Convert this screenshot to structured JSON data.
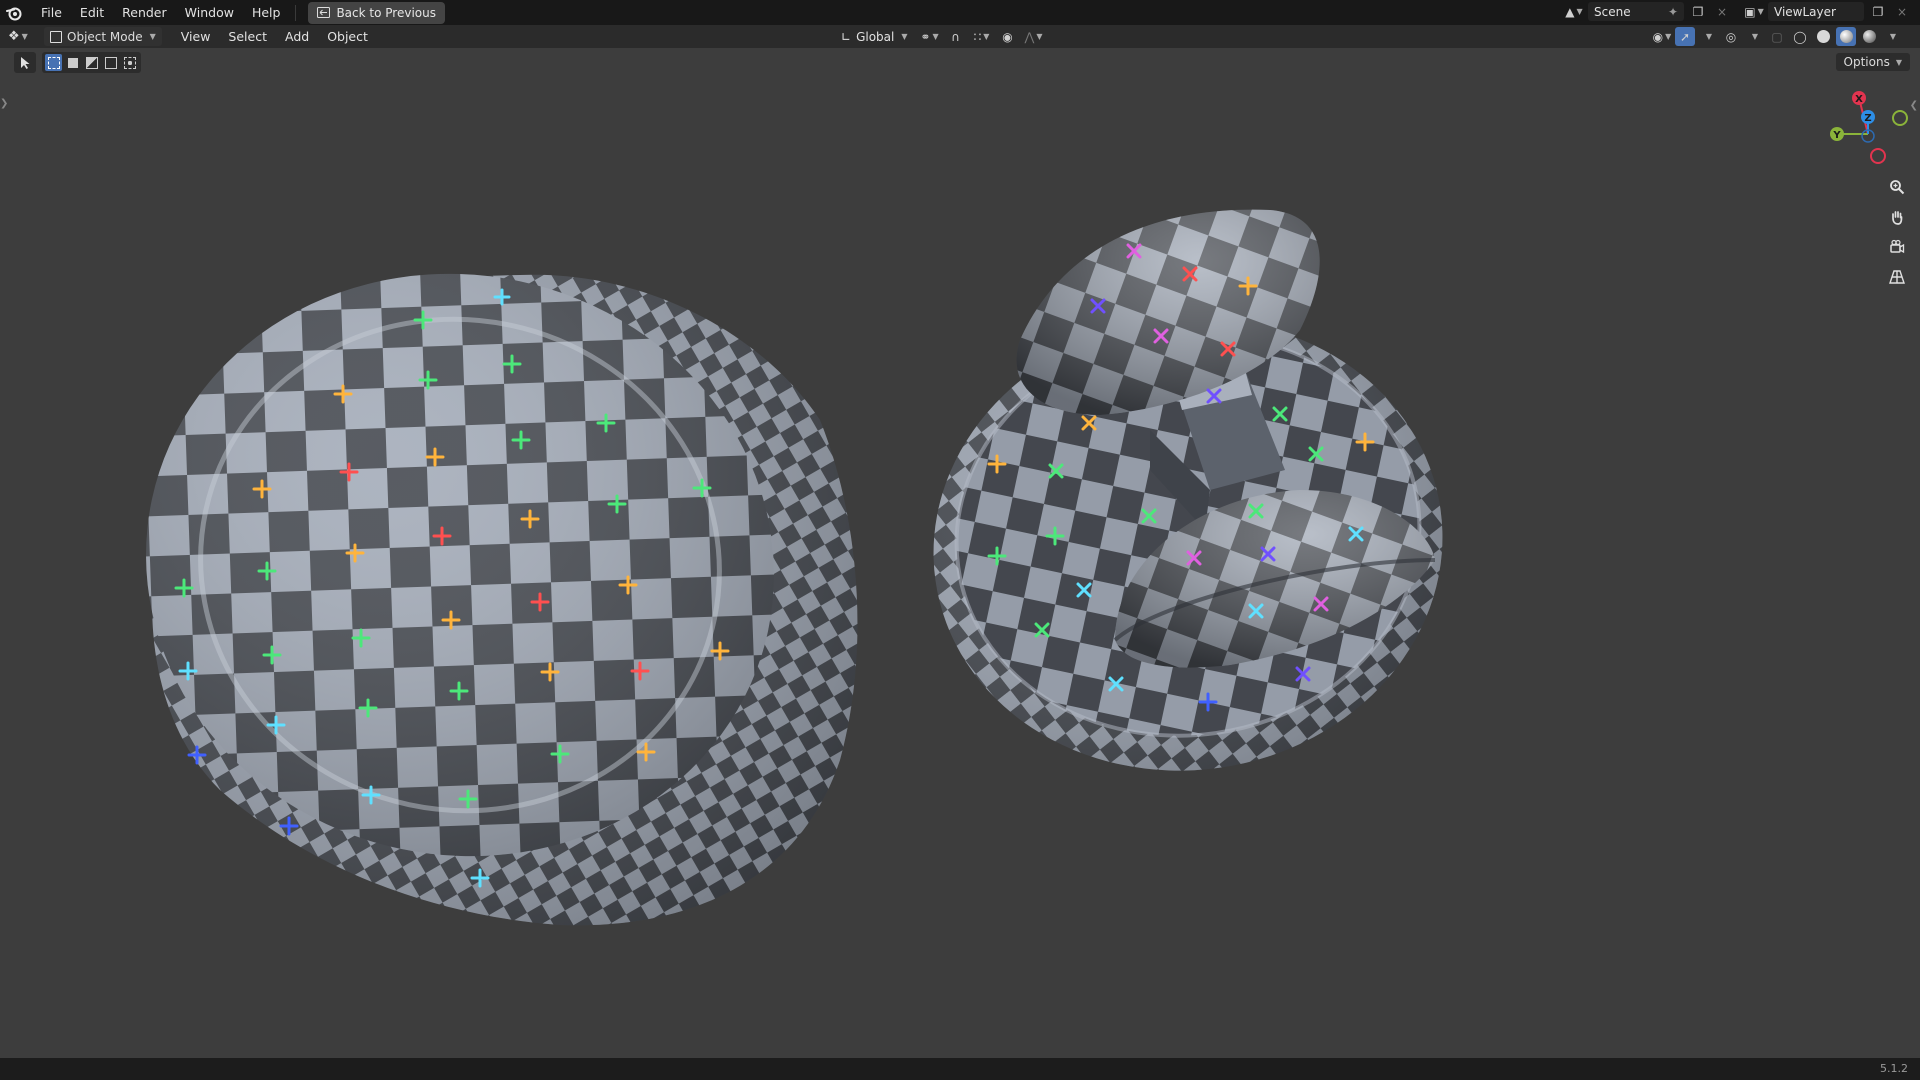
{
  "menu": {
    "items": [
      "File",
      "Edit",
      "Render",
      "Window",
      "Help"
    ],
    "back_button": "Back to Previous"
  },
  "top_right": {
    "scene_name": "Scene",
    "view_layer": "ViewLayer"
  },
  "header": {
    "mode": "Object Mode",
    "menus": [
      "View",
      "Select",
      "Add",
      "Object"
    ],
    "transform_orientation": "Global"
  },
  "options_label": "Options",
  "gizmo": {
    "x_label": "X",
    "y_label": "Y",
    "z_label": "Z",
    "colors": {
      "x": "#e2344f",
      "y": "#8bb43a",
      "z": "#2d8ee6"
    }
  },
  "nav_tools": [
    "zoom-icon",
    "hand-pan-icon",
    "camera-icon",
    "perspective-grid-icon"
  ],
  "status": {
    "version": "5.1.2"
  },
  "colors": {
    "viewport_bg": "#3d3d3d",
    "accent": "#4772b3",
    "checker_light": "#a6aebb",
    "checker_dark": "#4a4e55"
  }
}
